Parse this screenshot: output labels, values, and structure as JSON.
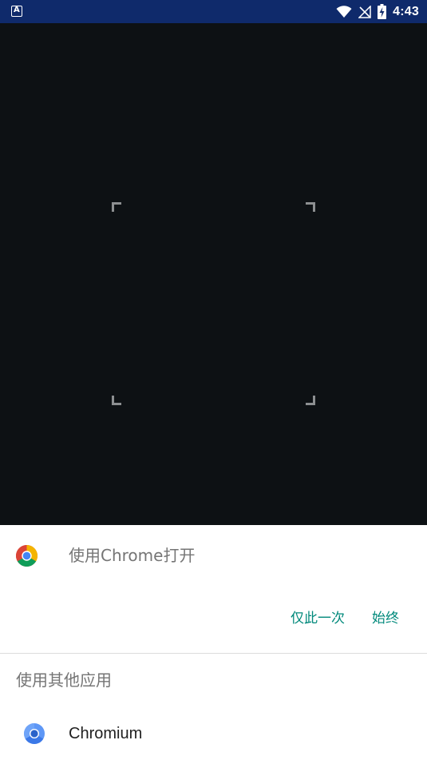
{
  "status_bar": {
    "time": "4:43",
    "notification_icon": "app-notification-icon",
    "notification_glyph": "A",
    "icons": [
      "wifi-icon",
      "signal-off-icon",
      "battery-charging-icon"
    ]
  },
  "scanner": {
    "frame_color": "#8c8f91"
  },
  "sheet": {
    "open_with_label": "使用Chrome打开",
    "once_button": "仅此一次",
    "always_button": "始终",
    "other_apps_heading": "使用其他应用",
    "apps": [
      {
        "label": "Chromium",
        "icon": "chromium-icon"
      }
    ],
    "accent_color": "#00897b"
  }
}
